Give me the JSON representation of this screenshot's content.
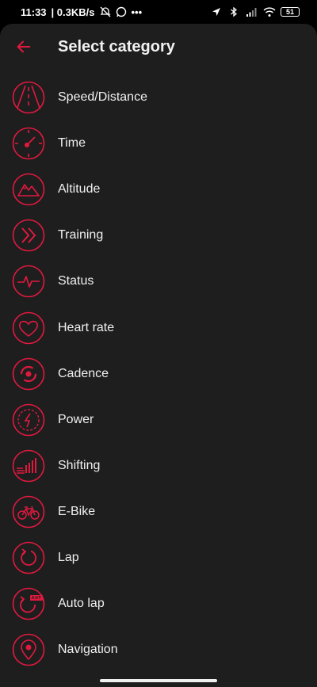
{
  "status_bar": {
    "time": "11:33",
    "speed": "| 0.3KB/s",
    "more": "•••",
    "battery": "51"
  },
  "header": {
    "title": "Select category"
  },
  "accent_color": "#e0193f",
  "categories": [
    {
      "label": "Speed/Distance",
      "icon": "road-icon"
    },
    {
      "label": "Time",
      "icon": "clock-icon"
    },
    {
      "label": "Altitude",
      "icon": "mountain-icon"
    },
    {
      "label": "Training",
      "icon": "chevrons-icon"
    },
    {
      "label": "Status",
      "icon": "pulse-icon"
    },
    {
      "label": "Heart rate",
      "icon": "heart-icon"
    },
    {
      "label": "Cadence",
      "icon": "cadence-icon"
    },
    {
      "label": "Power",
      "icon": "lightning-icon"
    },
    {
      "label": "Shifting",
      "icon": "shifting-icon"
    },
    {
      "label": "E-Bike",
      "icon": "bike-icon"
    },
    {
      "label": "Lap",
      "icon": "lap-icon"
    },
    {
      "label": "Auto lap",
      "icon": "auto-lap-icon"
    },
    {
      "label": "Navigation",
      "icon": "location-pin-icon"
    }
  ]
}
